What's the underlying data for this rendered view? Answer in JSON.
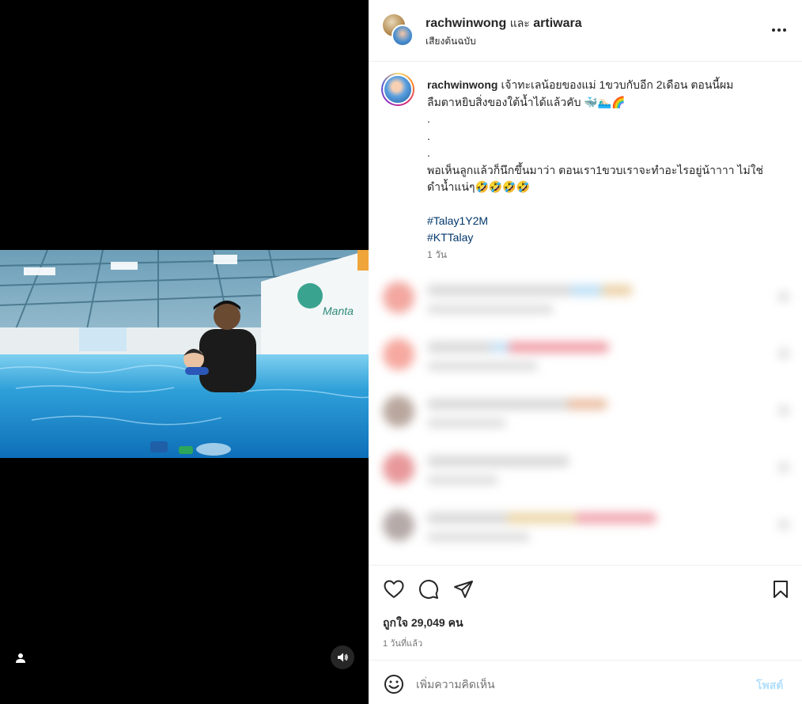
{
  "header": {
    "user1": "rachwinwong",
    "and": "และ",
    "user2": "artiwara",
    "audio": "เสียงต้นฉบับ"
  },
  "caption": {
    "username": "rachwinwong",
    "line1": "เจ้าทะเลน้อยของแม่ 1ขวบกับอีก 2เดือน ตอนนี้ผม",
    "line2": "ลืมตาหยิบสิ่งของใต้น้ำได้แล้วคับ 🐳🏊🏻‍♂️🌈",
    "dot1": ".",
    "dot2": ".",
    "dot3": ".",
    "line3": "พอเห็นลูกแล้วก็นึกขึ้นมาว่า ตอนเรา1ขวบเราจะทำอะไรอยู่น้าาาา ไม่ใช่",
    "line4": "ดำน้ำแน่ๆ🤣🤣🤣🤣",
    "hashtag1": "#Talay1Y2M",
    "hashtag2": "#KTTalay",
    "time": "1 วัน"
  },
  "actions": {
    "likes": "ถูกใจ 29,049 คน",
    "time": "1 วันที่แล้ว"
  },
  "comment_box": {
    "placeholder": "เพิ่มความคิดเห็น",
    "post_label": "โพสต์"
  },
  "icons": {
    "like": "heart-icon",
    "comment": "comment-icon",
    "share": "share-icon",
    "save": "bookmark-icon",
    "more": "more-icon",
    "emoji": "emoji-icon",
    "mute": "volume-icon",
    "tag": "user-tag-icon"
  },
  "colors": {
    "link": "#00376b",
    "post_button": "#b2dffc",
    "secondary_text": "#737373"
  }
}
